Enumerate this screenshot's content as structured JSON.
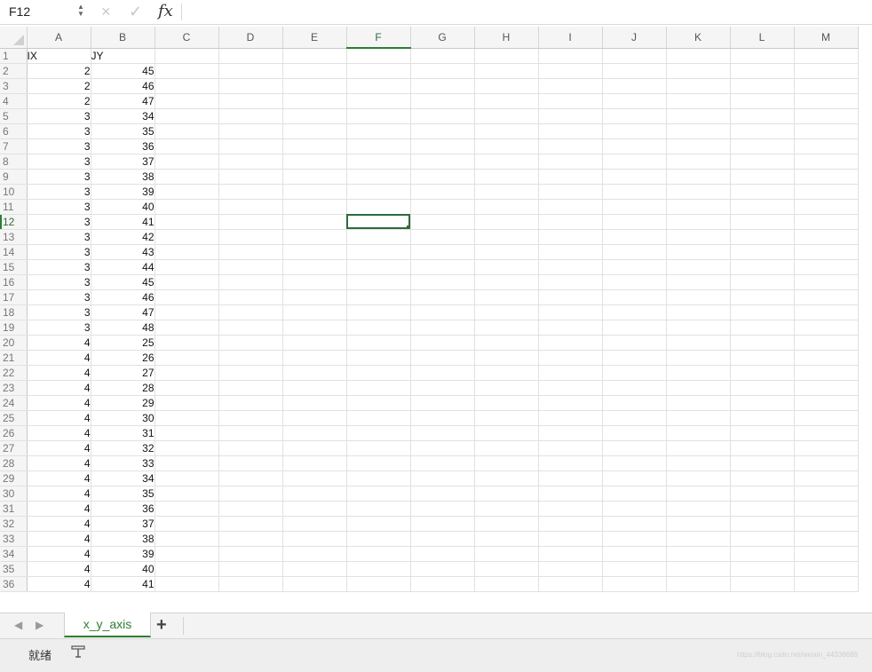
{
  "formula_bar": {
    "name_box": "F12",
    "cancel_icon": "×",
    "confirm_icon": "✓",
    "fx_label": "fx",
    "formula": ""
  },
  "columns": [
    "A",
    "B",
    "C",
    "D",
    "E",
    "F",
    "G",
    "H",
    "I",
    "J",
    "K",
    "L",
    "M"
  ],
  "selected": {
    "column": "F",
    "row": 12
  },
  "headers": {
    "A": "IX",
    "B": "JY"
  },
  "rows": [
    [
      2,
      45
    ],
    [
      2,
      46
    ],
    [
      2,
      47
    ],
    [
      3,
      34
    ],
    [
      3,
      35
    ],
    [
      3,
      36
    ],
    [
      3,
      37
    ],
    [
      3,
      38
    ],
    [
      3,
      39
    ],
    [
      3,
      40
    ],
    [
      3,
      41
    ],
    [
      3,
      42
    ],
    [
      3,
      43
    ],
    [
      3,
      44
    ],
    [
      3,
      45
    ],
    [
      3,
      46
    ],
    [
      3,
      47
    ],
    [
      3,
      48
    ],
    [
      4,
      25
    ],
    [
      4,
      26
    ],
    [
      4,
      27
    ],
    [
      4,
      28
    ],
    [
      4,
      29
    ],
    [
      4,
      30
    ],
    [
      4,
      31
    ],
    [
      4,
      32
    ],
    [
      4,
      33
    ],
    [
      4,
      34
    ],
    [
      4,
      35
    ],
    [
      4,
      36
    ],
    [
      4,
      37
    ],
    [
      4,
      38
    ],
    [
      4,
      39
    ],
    [
      4,
      40
    ],
    [
      4,
      41
    ]
  ],
  "tabs": {
    "prev_icon": "◀",
    "next_icon": "▶",
    "sheet_name": "x_y_axis",
    "add_label": "+"
  },
  "status": {
    "ready_text": "就绪",
    "icon": "record-macro-icon",
    "watermark": "https://blog.csdn.net/weixin_44338689"
  },
  "colors": {
    "accent": "#2e7d32",
    "header_bg": "#f5f5f5",
    "grid_line": "#e1e1e1"
  }
}
